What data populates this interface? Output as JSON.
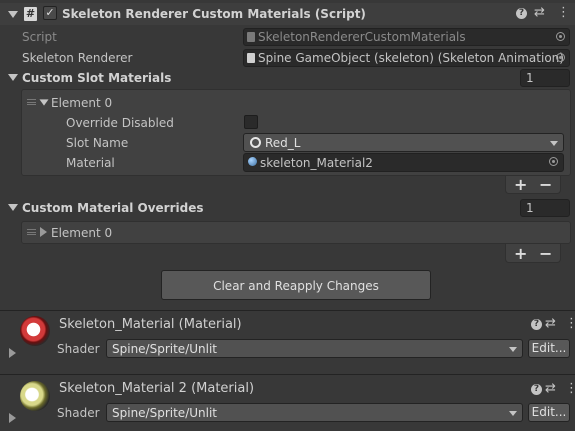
{
  "component": {
    "title": "Skeleton Renderer Custom Materials (Script)",
    "enabled": true,
    "script_label": "Script",
    "script_value": "SkeletonRendererCustomMaterials",
    "skeleton_renderer_label": "Skeleton Renderer",
    "skeleton_renderer_value": "Spine GameObject (skeleton) (Skeleton Animation)"
  },
  "custom_slot_materials": {
    "label": "Custom Slot Materials",
    "size": "1",
    "element_label": "Element 0",
    "override_disabled_label": "Override Disabled",
    "override_disabled_checked": false,
    "slot_name_label": "Slot Name",
    "slot_name_value": "Red_L",
    "material_label": "Material",
    "material_value": "skeleton_Material2",
    "add": "+",
    "remove": "−"
  },
  "custom_material_overrides": {
    "label": "Custom Material Overrides",
    "size": "1",
    "element_label": "Element 0",
    "add": "+",
    "remove": "−"
  },
  "clear_button": "Clear and Reapply Changes",
  "materials": [
    {
      "title": "Skeleton_Material (Material)",
      "shader_label": "Shader",
      "shader_value": "Spine/Sprite/Unlit",
      "edit": "Edit..."
    },
    {
      "title": "Skeleton_Material 2 (Material)",
      "shader_label": "Shader",
      "shader_value": "Spine/Sprite/Unlit",
      "edit": "Edit..."
    }
  ],
  "colors": {
    "background": "#383838",
    "field": "#2a2a2a",
    "button": "#585858",
    "text": "#c4c4c4"
  }
}
